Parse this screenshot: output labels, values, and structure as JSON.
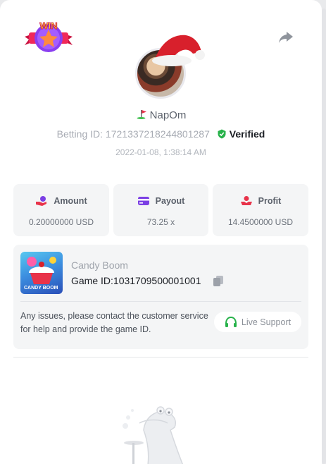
{
  "header": {
    "badge_text": "WIN",
    "share_icon": "share-arrow-icon"
  },
  "user": {
    "name": "NapOm",
    "flag_icon": "golf-flag-icon",
    "betting_id_label": "Betting ID:",
    "betting_id": "1721337218244801287",
    "verified_label": "Verified",
    "timestamp": "2022-01-08, 1:38:14 AM"
  },
  "stats": {
    "amount": {
      "label": "Amount",
      "value": "0.20000000 USD",
      "icon": "coins-hand-icon"
    },
    "payout": {
      "label": "Payout",
      "value": "73.25 x",
      "icon": "card-icon"
    },
    "profit": {
      "label": "Profit",
      "value": "14.4500000 USD",
      "icon": "profit-hand-icon"
    }
  },
  "game": {
    "name": "Candy Boom",
    "thumb_text": "CANDY BOOM",
    "id_label": "Game ID:",
    "id_value": "1031709500001001",
    "contact_text": "Any issues, please contact the customer service for help and provide the game ID.",
    "support_label": "Live Support"
  },
  "colors": {
    "accent_red": "#e8334a",
    "accent_purple": "#7b3fe4",
    "verified_green": "#27b24a",
    "panel_bg": "#f4f5f6"
  }
}
